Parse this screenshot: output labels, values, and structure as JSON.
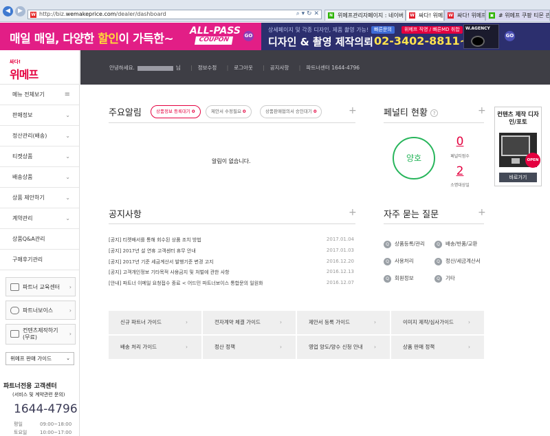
{
  "browser": {
    "url_prefix": "http://biz.",
    "url_domain": "wemakeprice.com",
    "url_path": "/dealer/dashboard",
    "addr_icons": "⌕ ▾ ↻ ✕",
    "tabs": [
      {
        "label": "위메프관리자페이지 : 네이버 ...",
        "favicon": "N",
        "color": "#2db400"
      },
      {
        "label": "싸다! 위메프",
        "favicon": "W",
        "color": "#e21e2b"
      },
      {
        "label": "싸다! 위메프",
        "favicon": "W",
        "color": "#e21e2b"
      },
      {
        "label": "# 위메프 쿠팡 티몬 관리",
        "favicon": "▣",
        "color": "#2db400"
      }
    ]
  },
  "banner": {
    "left_text_a": "매일 매일, 다양한 ",
    "left_text_b": "할인",
    "left_text_c": "이 가득한~",
    "coupon_top": "ALL-PASS",
    "coupon_bottom": "COUPON",
    "go": "GO",
    "sub": "상세페이지 및 각종 디자인, 제품 촬영 가능!",
    "pill1": "빠른문의",
    "pill2": "위메프 직영 / 빠른MD 취합",
    "main": "디자인 & 촬영 제작의뢰",
    "phone": "02-3402-8811~2",
    "cam_brand": "W.AGENCY"
  },
  "sidebar": {
    "logo_small": "싸다!",
    "logo": "위메프",
    "menu": [
      {
        "label": "메뉴 전체보기",
        "icon": "≡"
      },
      {
        "label": "판매정보",
        "icon": "⌄"
      },
      {
        "label": "정산관리(배송)",
        "icon": "⌄"
      },
      {
        "label": "티켓상품",
        "icon": "⌄"
      },
      {
        "label": "배송상품",
        "icon": "⌄"
      },
      {
        "label": "상품 제안하기",
        "icon": "⌄"
      },
      {
        "label": "계약관리",
        "icon": "⌄"
      },
      {
        "label": "상품Q&A관리",
        "icon": ""
      },
      {
        "label": "구매후기관리",
        "icon": ""
      }
    ],
    "buttons": [
      "파트너 교육센터",
      "파트너보이스",
      "컨텐츠제작하기 (무료)"
    ],
    "select_value": "위메프 판매 가이드",
    "cs_title": "파트너전용 고객센터",
    "cs_sub": "(서비스 및 계약관련 문의)",
    "cs_phone": "1644-4796",
    "hours": [
      {
        "day": "평일",
        "time": "09:00~18:00"
      },
      {
        "day": "토요일",
        "time": "10:00~17:00"
      }
    ]
  },
  "topnav": {
    "greeting": "안녕하세요.",
    "greeting_suffix": "님",
    "items": [
      "정보수정",
      "로그아웃",
      "공지사항",
      "파트너센터 1644-4796"
    ]
  },
  "alerts": {
    "title": "주요알림",
    "tabs": [
      {
        "label": "상품정보 등록대기",
        "count": "0"
      },
      {
        "label": "제안서 수정필요",
        "count": "0"
      },
      {
        "label": "상품판매협의서 승인대기",
        "count": "0"
      }
    ],
    "empty": "알림이 없습니다."
  },
  "penalty": {
    "title": "페널티 현황",
    "help": "?",
    "status": "양호",
    "score": "0",
    "score_label": "페널티점수",
    "count": "2",
    "count_label": "소명대상일"
  },
  "notices": {
    "title": "공지사항",
    "items": [
      {
        "title": "[공지] 티켓배서를 통해 회수된 상품 조치 방법",
        "date": "2017.01.04"
      },
      {
        "title": "[공지] 2017년 설 연휴 고객센터 휴무 안내",
        "date": "2017.01.03"
      },
      {
        "title": "[공지] 2017년 기준 세금계산서 발행기준 변경 고지",
        "date": "2016.12.20"
      },
      {
        "title": "[공지] 고객개인정보 기타목적 사용금지 및 처벌에 관한 사항",
        "date": "2016.12.13"
      },
      {
        "title": "[안내] 파트너 이메일 요청접수 종료 < 어드민 파트너보이스 통합문의 일원화",
        "date": "2016.12.07"
      }
    ]
  },
  "faq": {
    "title": "자주 묻는 질문",
    "items": [
      "상품등록/관리",
      "배송/반품/교환",
      "사용처리",
      "정산/세금계산서",
      "회원정보",
      "기타"
    ]
  },
  "guides": [
    "신규 파트너 가이드",
    "전자계약 체결 가이드",
    "제안서 등록 가이드",
    "이미지 제작/심사가이드",
    "배송 처리 가이드",
    "정산 정책",
    "영업 양도/양수 신청 안내",
    "상품 판매 정책"
  ],
  "ad": {
    "title": "컨텐츠 제작 디자인/포토",
    "open": "OPEN",
    "button": "바로가기"
  }
}
